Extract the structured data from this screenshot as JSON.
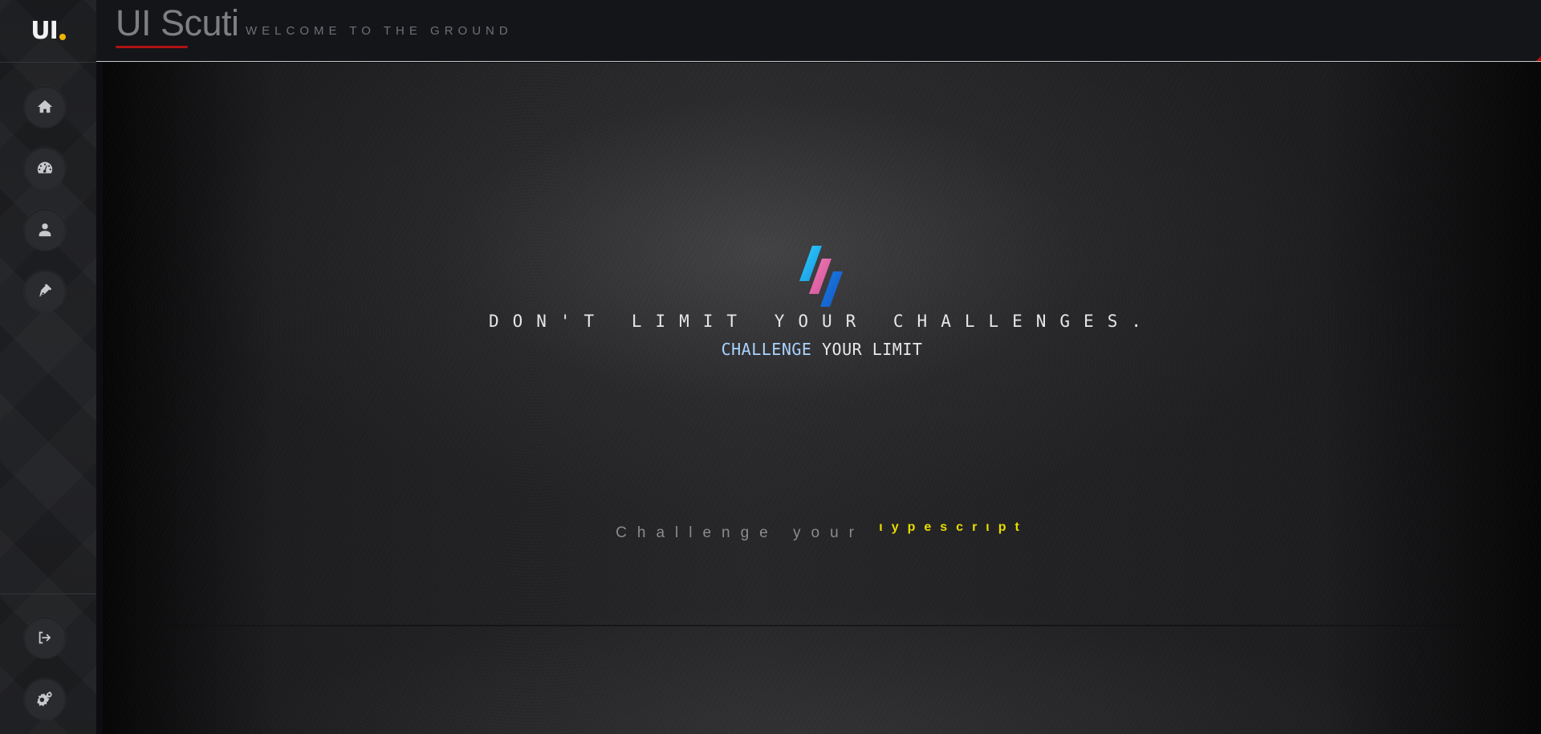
{
  "sidebar": {
    "logo": {
      "text": "UI",
      "dot_color": "#f0b400"
    },
    "nav": [
      {
        "icon": "home-icon"
      },
      {
        "icon": "dashboard-icon"
      },
      {
        "icon": "user-icon"
      },
      {
        "icon": "pen-icon"
      }
    ],
    "bottom": [
      {
        "icon": "logout-icon"
      },
      {
        "icon": "settings-icon"
      }
    ]
  },
  "header": {
    "title": "UI Scuti",
    "subtitle": "WELCOME TO THE GROUND",
    "accent_color": "#b01212"
  },
  "hero": {
    "heading": "DON'T LIMIT YOUR CHALLENGES.",
    "sub_accent": "CHALLENGE",
    "sub_rest": " YOUR LIMIT",
    "accent_color": "#a9d3ff"
  },
  "bottom_text": {
    "prefix": "Challenge your ",
    "typed": "ιypescrιpt",
    "typed_color": "#e8dc00"
  }
}
